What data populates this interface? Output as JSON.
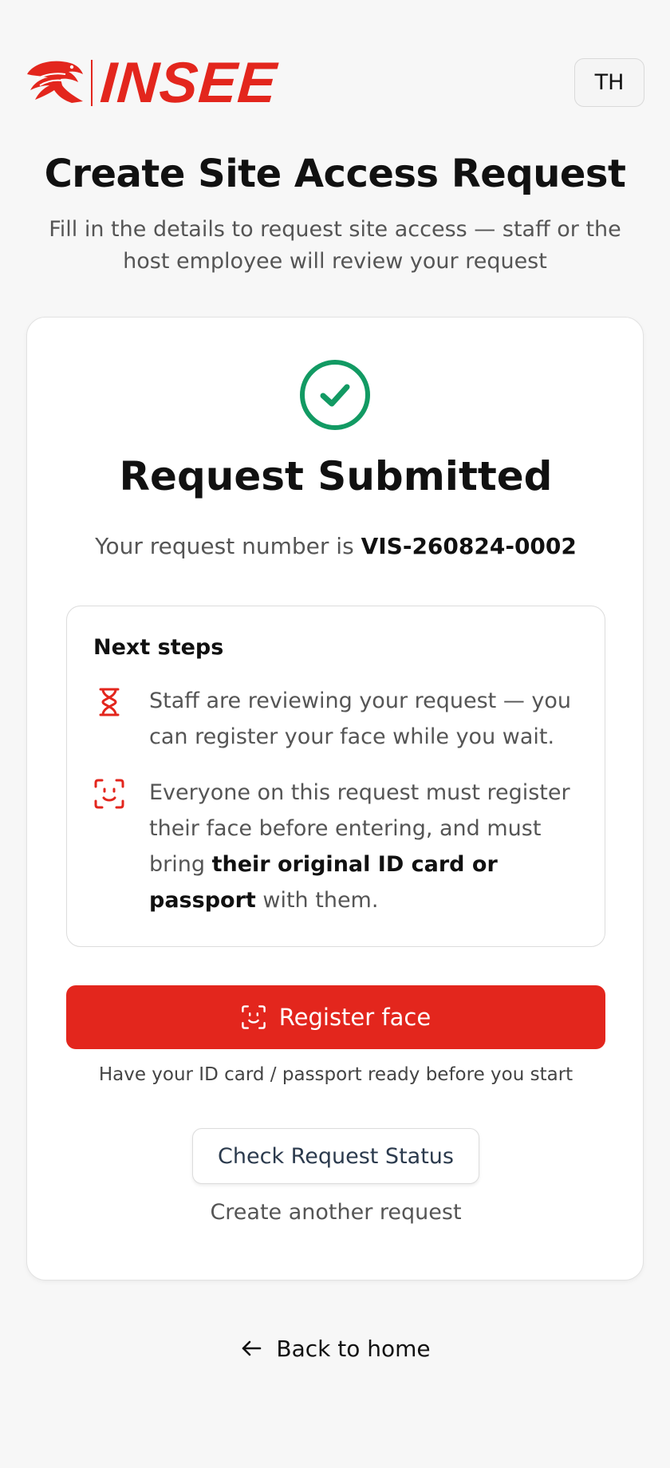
{
  "brand": {
    "name": "INSEE",
    "color": "#e3261d"
  },
  "header": {
    "language_label": "TH"
  },
  "page": {
    "title": "Create Site Access Request",
    "subtitle": "Fill in the details to request site access — staff or the host employee will review your request"
  },
  "card": {
    "status_icon": "check-circle-icon",
    "title": "Request Submitted",
    "request_prefix": "Your request number is ",
    "request_number": "VIS-260824-0002",
    "next_steps": {
      "title": "Next steps",
      "steps": [
        {
          "icon": "hourglass-icon",
          "text": "Staff are reviewing your request — you can register your face while you wait."
        },
        {
          "icon": "face-scan-icon",
          "text_before": "Everyone on this request must register their face before entering, and must bring ",
          "text_bold": "their original ID card or passport",
          "text_after": " with them."
        }
      ]
    },
    "register_button": "Register face",
    "register_hint": "Have your ID card / passport ready before you start",
    "check_status_button": "Check Request Status",
    "another_request_link": "Create another request"
  },
  "footer": {
    "back_link": "Back to home"
  },
  "colors": {
    "accent": "#e3261d",
    "success": "#129a63"
  }
}
